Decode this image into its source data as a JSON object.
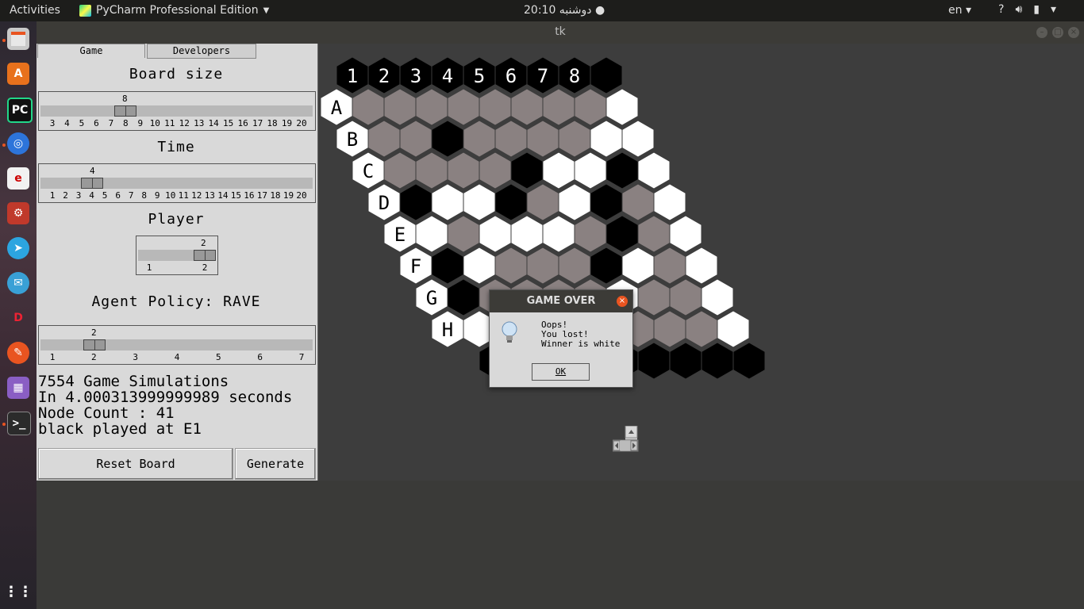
{
  "topbar": {
    "activities": "Activities",
    "app_name": "PyCharm Professional Edition",
    "clock": "دوشنبه 20:10",
    "lang": "en",
    "tray_icons": [
      "help-icon",
      "volume-icon",
      "battery-icon",
      "menu-icon"
    ]
  },
  "launcher": {
    "items": [
      "files-icon",
      "software-icon",
      "pycharm-icon",
      "chromium-icon",
      "document-viewer-icon",
      "settings-icon",
      "telegram-icon",
      "mail-icon",
      "game-icon",
      "brush-icon",
      "video-icon",
      "terminal-icon",
      "app-grid-icon"
    ]
  },
  "window": {
    "title": "tk"
  },
  "tabs": [
    "Game",
    "Developers"
  ],
  "board_size": {
    "title": "Board size",
    "value": "8",
    "ticks": [
      "3",
      "4",
      "5",
      "6",
      "7",
      "8",
      "9",
      "10",
      "11",
      "12",
      "13",
      "14",
      "15",
      "16",
      "17",
      "18",
      "19",
      "20"
    ]
  },
  "time": {
    "title": "Time",
    "value": "4",
    "ticks": [
      "1",
      "2",
      "3",
      "4",
      "5",
      "6",
      "7",
      "8",
      "9",
      "10",
      "11",
      "12",
      "13",
      "14",
      "15",
      "16",
      "17",
      "18",
      "19",
      "20"
    ]
  },
  "player": {
    "title": "Player",
    "value": "2",
    "ticks": [
      "1",
      "2"
    ]
  },
  "agent": {
    "title": "Agent Policy: RAVE",
    "value": "2",
    "ticks": [
      "1",
      "2",
      "3",
      "4",
      "5",
      "6",
      "7"
    ]
  },
  "stats": {
    "line1": "7554 Game Simulations",
    "line2": "In 4.000313999999989 seconds",
    "line3": "Node Count : 41",
    "line4": "black played at E1"
  },
  "buttons": {
    "reset": "Reset Board",
    "generate": "Generate"
  },
  "board": {
    "col_labels": [
      "1",
      "2",
      "3",
      "4",
      "5",
      "6",
      "7",
      "8"
    ],
    "row_labels": [
      "A",
      "B",
      "C",
      "D",
      "E",
      "F",
      "G",
      "H"
    ],
    "cells": [
      [
        "g",
        "g",
        "g",
        "g",
        "g",
        "g",
        "g",
        "g"
      ],
      [
        "g",
        "g",
        "b",
        "g",
        "g",
        "g",
        "g",
        "w"
      ],
      [
        "g",
        "g",
        "g",
        "g",
        "b",
        "w",
        "w",
        "b"
      ],
      [
        "b",
        "w",
        "w",
        "b",
        "g",
        "w",
        "b",
        "g"
      ],
      [
        "w",
        "g",
        "w",
        "w",
        "w",
        "g",
        "b",
        "g"
      ],
      [
        "b",
        "w",
        "g",
        "g",
        "g",
        "b",
        "w",
        "g"
      ],
      [
        "b",
        "g",
        "g",
        "g",
        "g",
        "w",
        "g",
        "g"
      ],
      [
        "w",
        "g",
        "b",
        "g",
        "b",
        "g",
        "g",
        "g"
      ]
    ],
    "colors": {
      "g": "#8a8181",
      "b": "#000000",
      "w": "#ffffff",
      "background": "#3d3d3d"
    }
  },
  "dialog": {
    "title": "GAME OVER",
    "message": "Oops!\nYou lost!\nWinner is white",
    "ok": "OK"
  }
}
